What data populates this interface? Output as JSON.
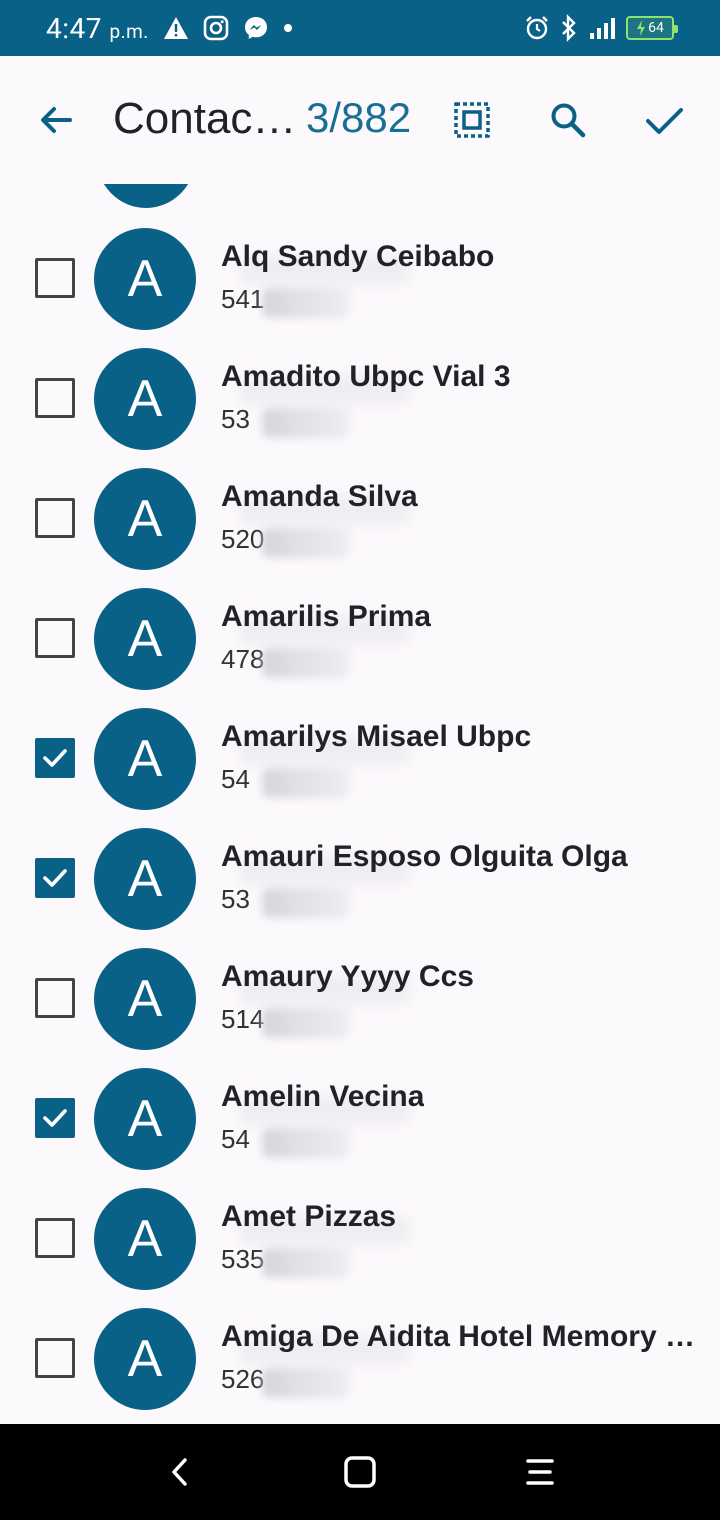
{
  "status_bar": {
    "time": "4:47",
    "ampm": "p.m.",
    "battery": "64"
  },
  "app_bar": {
    "title": "Contac…",
    "count": "3/882"
  },
  "contacts": [
    {
      "initial": "A",
      "name": "Alq  Sandy  Ceibabo",
      "phone_visible": "541",
      "checked": false
    },
    {
      "initial": "A",
      "name": "Amadito Ubpc Vial 3",
      "phone_visible": "53",
      "checked": false
    },
    {
      "initial": "A",
      "name": "Amanda Silva",
      "phone_visible": "520",
      "checked": false
    },
    {
      "initial": "A",
      "name": "Amarilis  Prima",
      "phone_visible": "478",
      "checked": false
    },
    {
      "initial": "A",
      "name": "Amarilys Misael Ubpc",
      "phone_visible": "54",
      "checked": true
    },
    {
      "initial": "A",
      "name": "Amauri Esposo Olguita Olga",
      "phone_visible": "53",
      "checked": true
    },
    {
      "initial": "A",
      "name": "Amaury Yyyy Ccs",
      "phone_visible": "514",
      "checked": false
    },
    {
      "initial": "A",
      "name": "Amelin Vecina",
      "phone_visible": "54",
      "checked": true
    },
    {
      "initial": "A",
      "name": "Amet Pizzas",
      "phone_visible": "535",
      "checked": false
    },
    {
      "initial": "A",
      "name": "Amiga De Aidita Hotel Memory …",
      "phone_visible": "526",
      "checked": false
    }
  ],
  "colors": {
    "primary": "#0a6187",
    "accent_text": "#1a6e93",
    "background": "#fcf9fc"
  },
  "icons": {
    "back": "arrow-left-icon",
    "select_all": "select-all-icon",
    "search": "search-icon",
    "done": "check-icon"
  }
}
